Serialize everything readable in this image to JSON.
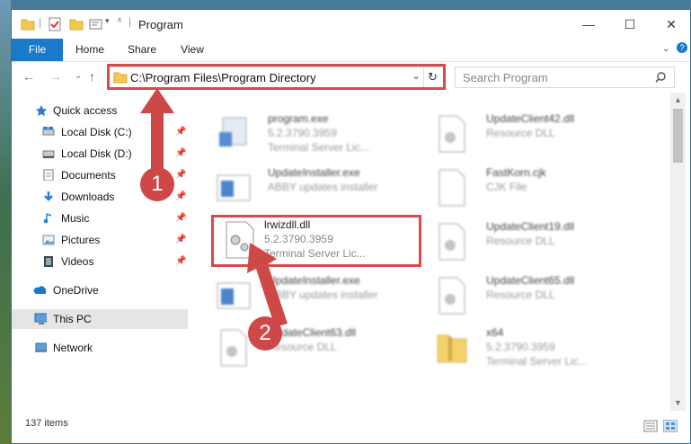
{
  "window": {
    "title": "Program",
    "min_glyph": "—",
    "max_glyph": "☐",
    "close_glyph": "✕"
  },
  "ribbon": {
    "tabs": [
      "File",
      "Home",
      "Share",
      "View"
    ]
  },
  "address": {
    "path": "C:\\Program Files\\Program Directory",
    "refresh_glyph": "↻",
    "dropdown_glyph": "⌄"
  },
  "search": {
    "placeholder": "Search Program"
  },
  "nav": {
    "back": "←",
    "forward": "→",
    "recent": "⌄",
    "up": "↑"
  },
  "sidebar": {
    "items": [
      {
        "label": "Quick access",
        "icon": "star-icon",
        "pinned": false
      },
      {
        "label": "Local Disk (C:)",
        "icon": "drive-icon",
        "pinned": true
      },
      {
        "label": "Local Disk (D:)",
        "icon": "drive-icon",
        "pinned": true
      },
      {
        "label": "Documents",
        "icon": "documents-icon",
        "pinned": true
      },
      {
        "label": "Downloads",
        "icon": "download-icon",
        "pinned": true
      },
      {
        "label": "Music",
        "icon": "music-icon",
        "pinned": true
      },
      {
        "label": "Pictures",
        "icon": "pictures-icon",
        "pinned": true
      },
      {
        "label": "Videos",
        "icon": "videos-icon",
        "pinned": true
      },
      {
        "label": "OneDrive",
        "icon": "cloud-icon",
        "pinned": false
      },
      {
        "label": "This PC",
        "icon": "computer-icon",
        "pinned": false
      },
      {
        "label": "Network",
        "icon": "network-icon",
        "pinned": false
      }
    ]
  },
  "files": [
    {
      "name": "program.exe",
      "line2": "5.2.3790.3959",
      "line3": "Terminal Server Lic...",
      "icon": "installer-icon",
      "blurred": true
    },
    {
      "name": "UpdateClient42.dll",
      "line2": "Resource DLL",
      "line3": "",
      "icon": "dll-icon",
      "blurred": true
    },
    {
      "name": "UpdateInstaller.exe",
      "line2": "ABBY updates installer",
      "line3": "",
      "icon": "app-window-icon",
      "blurred": true
    },
    {
      "name": "FastKorn.cjk",
      "line2": "CJK File",
      "line3": "",
      "icon": "blank-file-icon",
      "blurred": true
    },
    {
      "name": "lrwizdll.dll",
      "line2": "5.2.3790.3959",
      "line3": "Terminal Server Lic...",
      "icon": "dll-gears-icon",
      "blurred": false
    },
    {
      "name": "UpdateClient19.dll",
      "line2": "Resource DLL",
      "line3": "",
      "icon": "dll-icon",
      "blurred": true
    },
    {
      "name": "UpdateInstaller.exe",
      "line2": "ABBY updates installer",
      "line3": "",
      "icon": "app-window-icon",
      "blurred": true
    },
    {
      "name": "UpdateClient65.dll",
      "line2": "Resource DLL",
      "line3": "",
      "icon": "dll-icon",
      "blurred": true
    },
    {
      "name": "UpdateClient63.dll",
      "line2": "Resource DLL",
      "line3": "",
      "icon": "dll-icon",
      "blurred": true
    },
    {
      "name": "x64",
      "line2": "5.2.3790.3959",
      "line3": "Terminal Server Lic...",
      "icon": "folder-zip-icon",
      "blurred": true
    }
  ],
  "status": {
    "count": "137 items"
  },
  "callouts": [
    {
      "number": "1"
    },
    {
      "number": "2"
    }
  ],
  "colors": {
    "accent": "#1979ca",
    "highlight": "#d94b4b",
    "badge": "#cf4848"
  }
}
